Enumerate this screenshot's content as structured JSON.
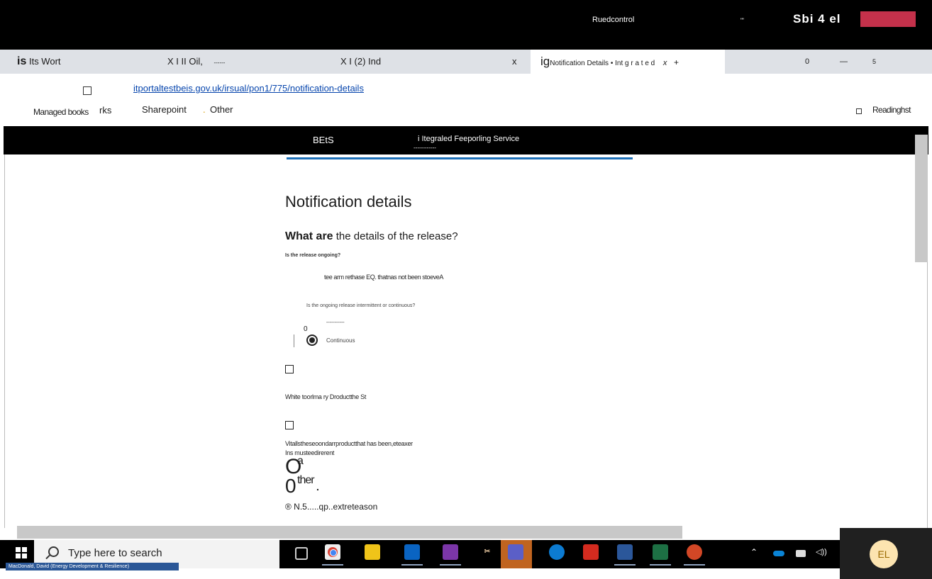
{
  "titlebar": {
    "right_label": "Ruedcontrol",
    "dots": "\"'",
    "brand": "Sbi 4 el",
    "accent": "#c4314b"
  },
  "tabs": [
    {
      "icon_text": "is",
      "label": "Its Wort"
    },
    {
      "label": "X I II Oil,",
      "trail": "------"
    },
    {
      "label": "X I (2) Ind",
      "close": "x"
    },
    {
      "icon_text": "ig",
      "label": "Notification Details • Int g r a t e d",
      "close": "x",
      "plus": "+"
    }
  ],
  "window_controls": {
    "zero": "0",
    "minimize": "—",
    "five": "5"
  },
  "address_url": "itportaltestbeis.gov.uk/irsual/pon1/775/notification-details",
  "bookmarks": {
    "managed": "Managed books",
    "rks": "rks",
    "sharepoint": "Sharepoint",
    "dot": ".",
    "other": "Other",
    "reading": "Readinghst"
  },
  "site_header": {
    "brand": "BEtS",
    "service": "i Itegraled Feeporling Service",
    "underline": "------------"
  },
  "page": {
    "title": "Notification details",
    "question_bold": "What are",
    "question_rest": "the details of the release?",
    "ongoing_label": "Is the release ongoing?",
    "ongoing_hint": "tee arm rethase EQ. thatnas not been stoeveA",
    "intermittent_label": "Is the ongoing release intermittent or continuous?",
    "dash_line": "-----------",
    "zero": "0",
    "continuous_label": "Continuous",
    "product_label": "White toorlma ry Droductthe St",
    "secondary_label": "Vitallstheseoondarrproductthat has been,eteaxer",
    "secondary_hint": "Ins musteedirerent",
    "other_O": "O",
    "other_a": "a",
    "other_zero": "0",
    "other_ther": "ther",
    "other_dot": ".",
    "reason": "® N.5.....qp..extreteason"
  },
  "taskbar": {
    "search_placeholder": "Type here to search",
    "user": "MacDonald, David (Energy Development & Resilience)",
    "avatar": "EL",
    "icons": [
      "task-view",
      "chrome",
      "file-explorer",
      "outlook",
      "onenote",
      "snip",
      "teams",
      "edge",
      "acrobat",
      "word",
      "excel",
      "powerpoint"
    ]
  }
}
